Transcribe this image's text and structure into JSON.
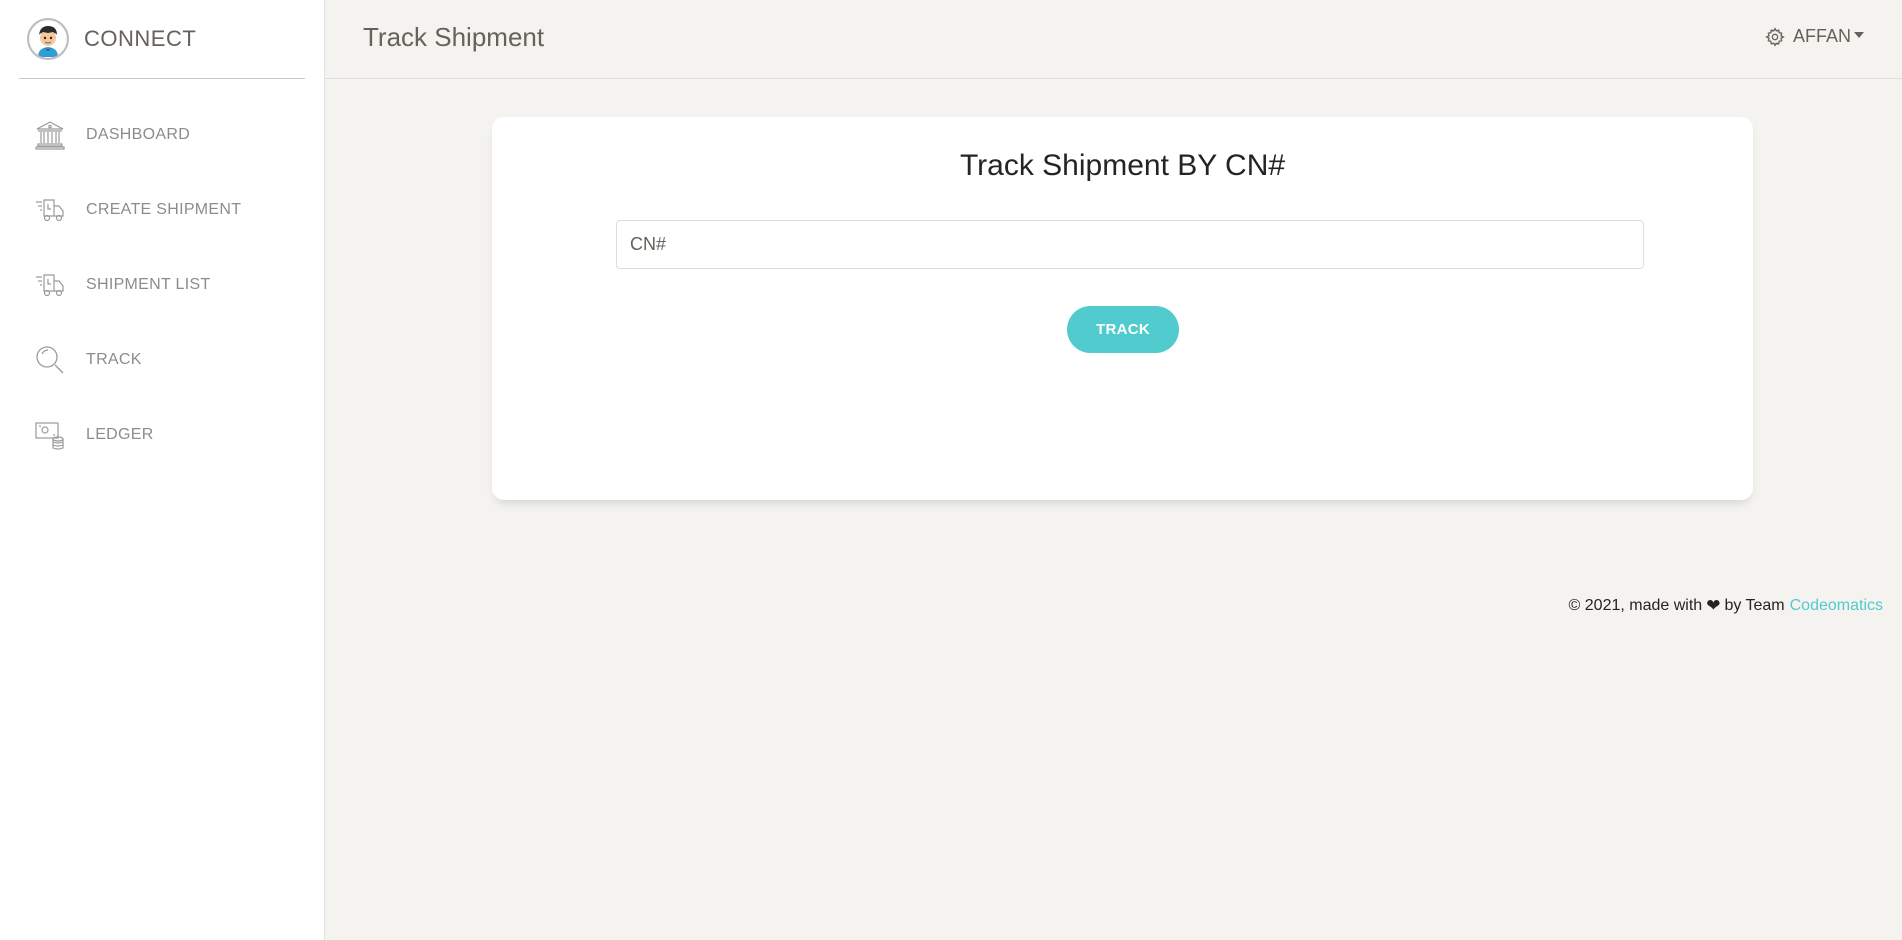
{
  "sidebar": {
    "brand": {
      "name": "CONNECT",
      "avatar_icon": "user-avatar-icon"
    },
    "items": [
      {
        "label": "DASHBOARD",
        "icon": "bank-icon"
      },
      {
        "label": "CREATE SHIPMENT",
        "icon": "delivery-truck-icon"
      },
      {
        "label": "SHIPMENT LIST",
        "icon": "delivery-truck-icon"
      },
      {
        "label": "TRACK",
        "icon": "search-icon"
      },
      {
        "label": "LEDGER",
        "icon": "money-ledger-icon"
      }
    ]
  },
  "header": {
    "title": "Track Shipment",
    "user": {
      "name": "AFFAN",
      "icon": "gear-icon"
    }
  },
  "card": {
    "title": "Track Shipment BY CN#",
    "input": {
      "placeholder": "CN#",
      "value": ""
    },
    "button_label": "TRACK"
  },
  "footer": {
    "prefix": "© 2021, made with",
    "middle": "by Team",
    "link_text": "Codeomatics"
  },
  "colors": {
    "accent": "#51cbce",
    "background": "#f4f3ef",
    "text": "#66615b"
  }
}
